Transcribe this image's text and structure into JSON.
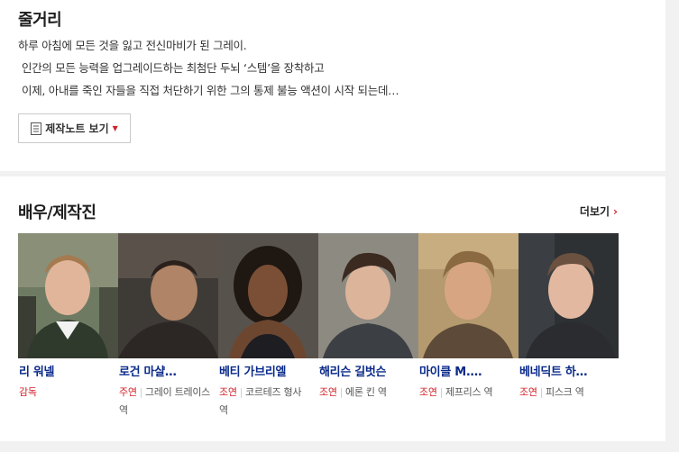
{
  "synopsis": {
    "title": "줄거리",
    "lines": [
      "하루 아침에 모든 것을 잃고 전신마비가 된 그레이.",
      "인간의 모든 능력을 업그레이드하는 최첨단 두뇌 ‘스템’을 장착하고",
      "이제, 아내를 죽인 자들을 직접 처단하기 위한 그의 통제 불능 액션이 시작 되는데…"
    ],
    "note_button_label": "제작노트 보기"
  },
  "cast": {
    "title": "배우/제작진",
    "more_label": "더보기",
    "members": [
      {
        "name": "리 워넬",
        "role_type": "감독",
        "role": ""
      },
      {
        "name": "로건 마샬…",
        "role_type": "주연",
        "role": "그레이 트레이스 역"
      },
      {
        "name": "베티 가브리엘",
        "role_type": "조연",
        "role": "코르테즈 형사 역"
      },
      {
        "name": "해리슨 길벗슨",
        "role_type": "조연",
        "role": "에론 킨 역"
      },
      {
        "name": "마이클 M.…",
        "role_type": "조연",
        "role": "제프리스 역"
      },
      {
        "name": "베네딕트 하…",
        "role_type": "조연",
        "role": "피스크 역"
      }
    ]
  },
  "colors": {
    "accent": "#d1232a",
    "name_link": "#0a2a8a"
  }
}
